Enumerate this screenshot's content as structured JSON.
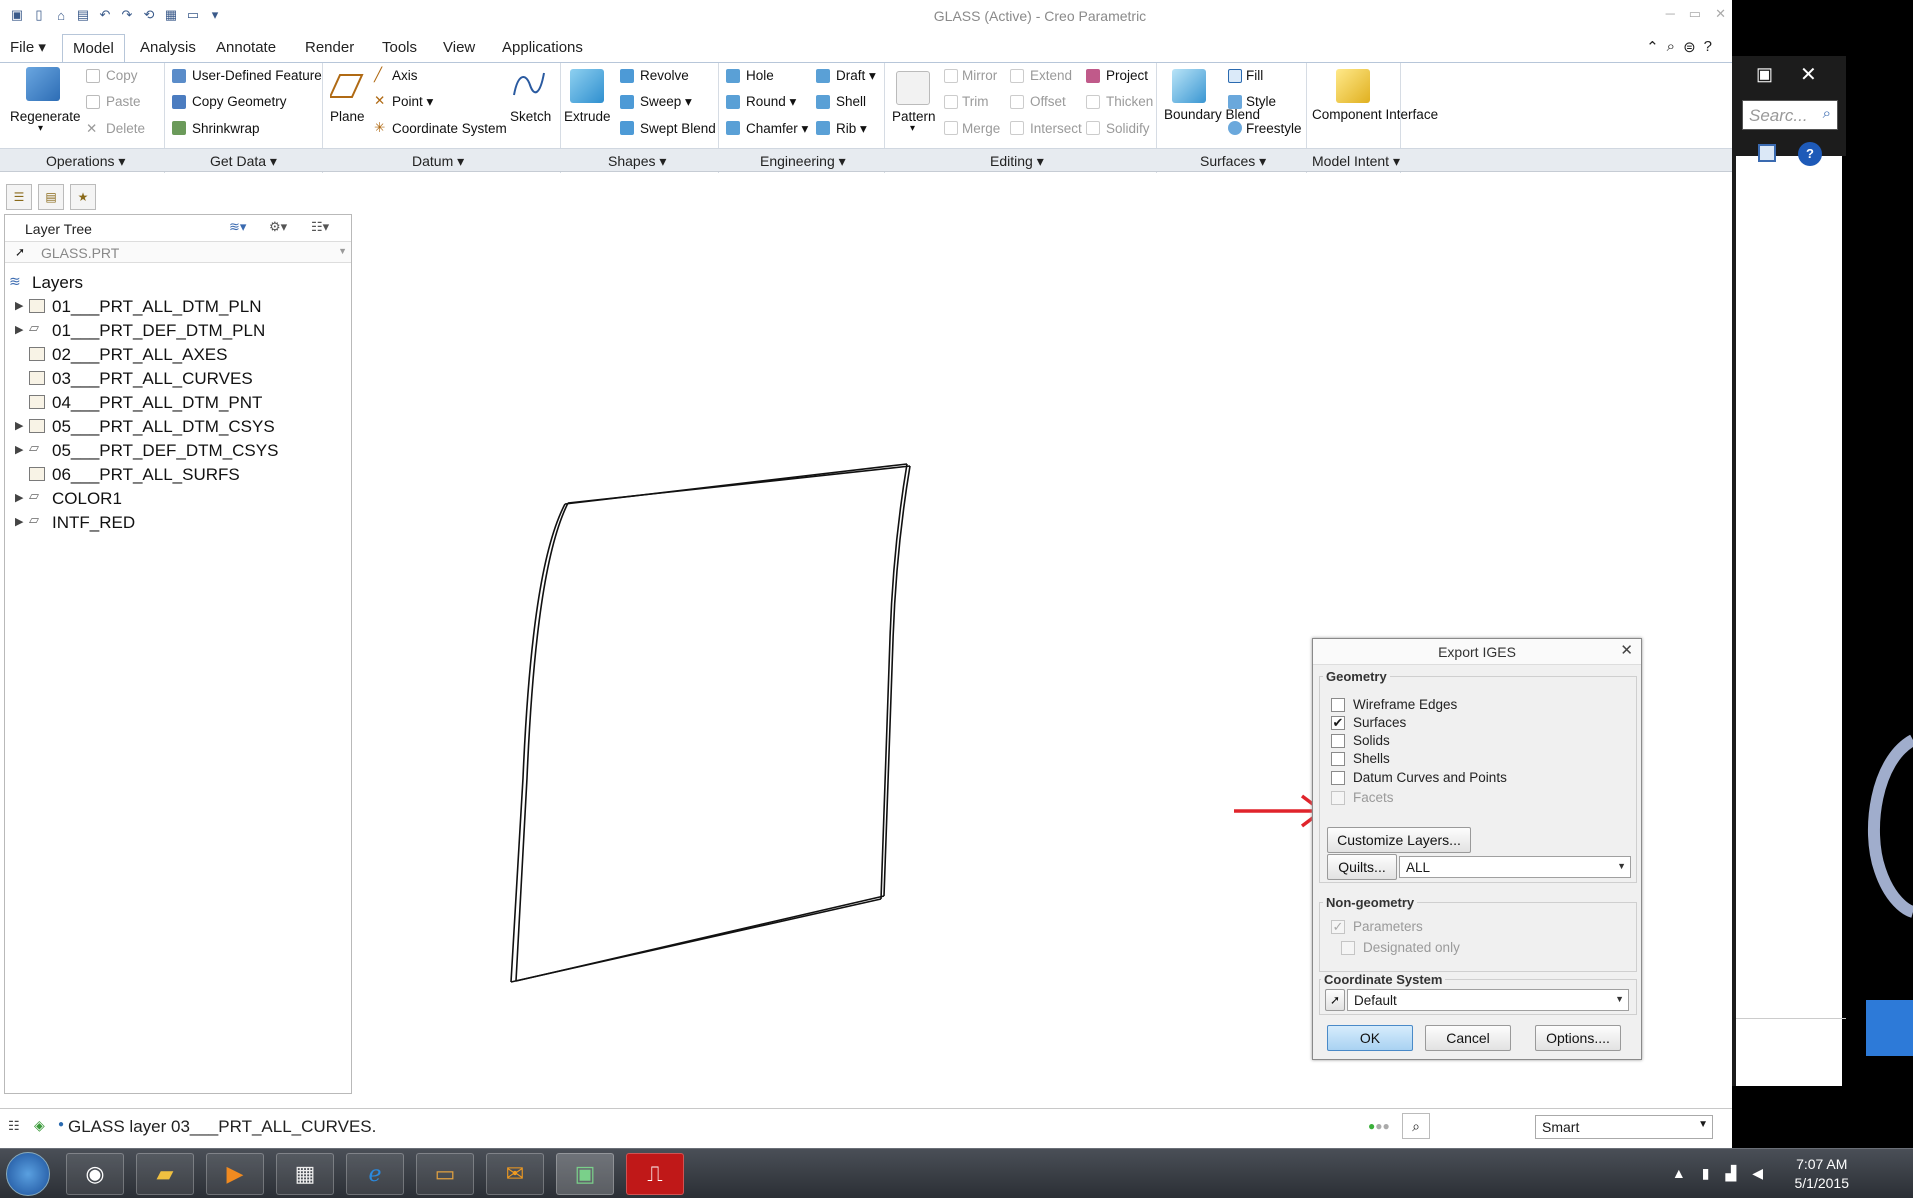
{
  "app": {
    "title": "GLASS (Active) - Creo Parametric"
  },
  "menu": {
    "tabs": [
      "File",
      "Model",
      "Analysis",
      "Annotate",
      "Render",
      "Tools",
      "View",
      "Applications"
    ],
    "active": "Model"
  },
  "ribbon": {
    "operations": {
      "regenerate": "Regenerate",
      "copy": "Copy",
      "paste": "Paste",
      "delete": "Delete"
    },
    "get_data": {
      "udf": "User-Defined Feature",
      "copy_geometry": "Copy Geometry",
      "shrinkwrap": "Shrinkwrap"
    },
    "datum": {
      "plane": "Plane",
      "axis": "Axis",
      "point": "Point",
      "csys": "Coordinate System",
      "sketch": "Sketch"
    },
    "shapes": {
      "extrude": "Extrude",
      "revolve": "Revolve",
      "sweep": "Sweep",
      "swept_blend": "Swept Blend"
    },
    "engineering": {
      "hole": "Hole",
      "round": "Round",
      "chamfer": "Chamfer",
      "draft": "Draft",
      "shell": "Shell",
      "rib": "Rib"
    },
    "editing": {
      "pattern": "Pattern",
      "mirror": "Mirror",
      "trim": "Trim",
      "merge": "Merge",
      "extend": "Extend",
      "offset": "Offset",
      "intersect": "Intersect",
      "project": "Project",
      "thicken": "Thicken",
      "solidify": "Solidify"
    },
    "surfaces": {
      "boundary_blend": "Boundary Blend",
      "fill": "Fill",
      "style": "Style",
      "freestyle": "Freestyle"
    },
    "model_intent": {
      "component_interface": "Component Interface"
    },
    "groups": [
      "Operations",
      "Get Data",
      "Datum",
      "Shapes",
      "Engineering",
      "Editing",
      "Surfaces",
      "Model Intent"
    ]
  },
  "layer_tree": {
    "title": "Layer Tree",
    "model": "GLASS.PRT",
    "root": "Layers",
    "layers": [
      {
        "name": "01___PRT_ALL_DTM_PLN",
        "expandable": true
      },
      {
        "name": "01___PRT_DEF_DTM_PLN",
        "expandable": true
      },
      {
        "name": "02___PRT_ALL_AXES",
        "expandable": false
      },
      {
        "name": "03___PRT_ALL_CURVES",
        "expandable": false
      },
      {
        "name": "04___PRT_ALL_DTM_PNT",
        "expandable": false
      },
      {
        "name": "05___PRT_ALL_DTM_CSYS",
        "expandable": true
      },
      {
        "name": "05___PRT_DEF_DTM_CSYS",
        "expandable": true
      },
      {
        "name": "06___PRT_ALL_SURFS",
        "expandable": false
      },
      {
        "name": "COLOR1",
        "expandable": true
      },
      {
        "name": "INTF_RED",
        "expandable": true
      }
    ]
  },
  "dialog": {
    "title": "Export IGES",
    "geometry_label": "Geometry",
    "options": [
      {
        "label": "Wireframe Edges",
        "checked": false,
        "enabled": true
      },
      {
        "label": "Surfaces",
        "checked": true,
        "enabled": true
      },
      {
        "label": "Solids",
        "checked": false,
        "enabled": true
      },
      {
        "label": "Shells",
        "checked": false,
        "enabled": true
      },
      {
        "label": "Datum Curves and Points",
        "checked": false,
        "enabled": true
      },
      {
        "label": "Facets",
        "checked": false,
        "enabled": false
      }
    ],
    "customize_layers": "Customize Layers...",
    "quilts_button": "Quilts...",
    "quilts_value": "ALL",
    "nongeometry_label": "Non-geometry",
    "parameters": "Parameters",
    "designated_only": "Designated only",
    "csys_label": "Coordinate System",
    "csys_value": "Default",
    "ok": "OK",
    "cancel": "Cancel",
    "options_button": "Options...."
  },
  "status": {
    "message": "GLASS layer 03___PRT_ALL_CURVES.",
    "filter": "Smart"
  },
  "side_window": {
    "search_placeholder": "Searc..."
  },
  "taskbar": {
    "time": "7:07 AM",
    "date": "5/1/2015"
  },
  "colors": {
    "accent": "#3c78c8",
    "annotation_arrow": "#e0242b",
    "ok_button": "#bcdcf7"
  }
}
